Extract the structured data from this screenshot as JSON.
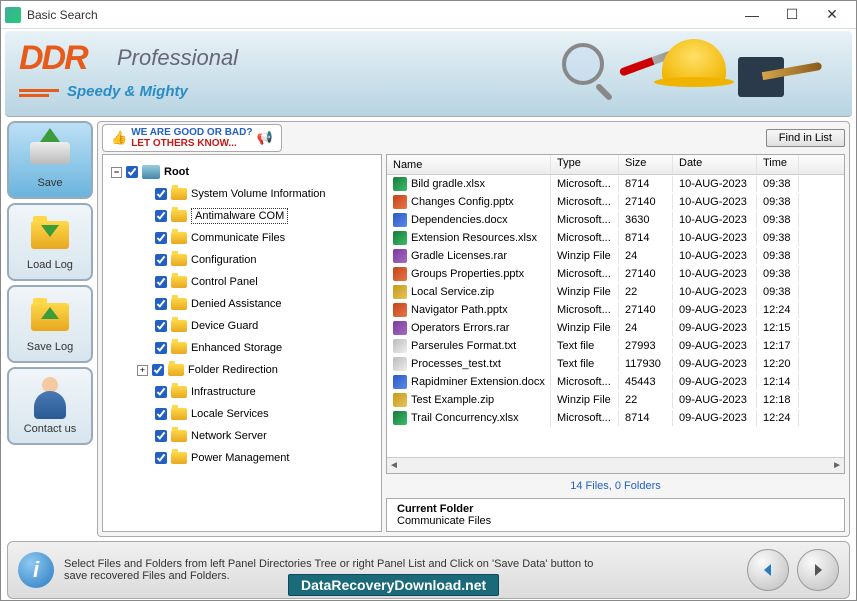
{
  "window": {
    "title": "Basic Search"
  },
  "banner": {
    "brand": "DDR",
    "edition": "Professional",
    "tagline": "Speedy & Mighty"
  },
  "sidebar": {
    "items": [
      {
        "id": "save",
        "label": "Save"
      },
      {
        "id": "load-log",
        "label": "Load Log"
      },
      {
        "id": "save-log",
        "label": "Save Log"
      },
      {
        "id": "contact",
        "label": "Contact us"
      }
    ]
  },
  "promo": {
    "line1": "WE ARE GOOD OR BAD?",
    "line2": "LET OTHERS KNOW..."
  },
  "find_button": "Find in List",
  "tree": {
    "root": "Root",
    "children": [
      "System Volume Information",
      "Antimalware COM",
      "Communicate Files",
      "Configuration",
      "Control Panel",
      "Denied Assistance",
      "Device Guard",
      "Enhanced Storage",
      "Folder Redirection",
      "Infrastructure",
      "Locale Services",
      "Network Server",
      "Power Management"
    ],
    "selected_index": 1,
    "expandable_child_index": 8
  },
  "list": {
    "columns": [
      "Name",
      "Type",
      "Size",
      "Date",
      "Time"
    ],
    "rows": [
      {
        "icon": "xlsx",
        "name": "Bild gradle.xlsx",
        "type": "Microsoft...",
        "size": "8714",
        "date": "10-AUG-2023",
        "time": "09:38"
      },
      {
        "icon": "pptx",
        "name": "Changes Config.pptx",
        "type": "Microsoft...",
        "size": "27140",
        "date": "10-AUG-2023",
        "time": "09:38"
      },
      {
        "icon": "docx",
        "name": "Dependencies.docx",
        "type": "Microsoft...",
        "size": "3630",
        "date": "10-AUG-2023",
        "time": "09:38"
      },
      {
        "icon": "xlsx",
        "name": "Extension Resources.xlsx",
        "type": "Microsoft...",
        "size": "8714",
        "date": "10-AUG-2023",
        "time": "09:38"
      },
      {
        "icon": "rar",
        "name": "Gradle Licenses.rar",
        "type": "Winzip File",
        "size": "24",
        "date": "10-AUG-2023",
        "time": "09:38"
      },
      {
        "icon": "pptx",
        "name": "Groups Properties.pptx",
        "type": "Microsoft...",
        "size": "27140",
        "date": "10-AUG-2023",
        "time": "09:38"
      },
      {
        "icon": "zip",
        "name": "Local Service.zip",
        "type": "Winzip File",
        "size": "22",
        "date": "10-AUG-2023",
        "time": "09:38"
      },
      {
        "icon": "pptx",
        "name": "Navigator Path.pptx",
        "type": "Microsoft...",
        "size": "27140",
        "date": "09-AUG-2023",
        "time": "12:24"
      },
      {
        "icon": "rar",
        "name": "Operators Errors.rar",
        "type": "Winzip File",
        "size": "24",
        "date": "09-AUG-2023",
        "time": "12:15"
      },
      {
        "icon": "txt",
        "name": "Parserules Format.txt",
        "type": "Text file",
        "size": "27993",
        "date": "09-AUG-2023",
        "time": "12:17"
      },
      {
        "icon": "txt",
        "name": "Processes_test.txt",
        "type": "Text file",
        "size": "117930",
        "date": "09-AUG-2023",
        "time": "12:20"
      },
      {
        "icon": "docx",
        "name": "Rapidminer Extension.docx",
        "type": "Microsoft...",
        "size": "45443",
        "date": "09-AUG-2023",
        "time": "12:14"
      },
      {
        "icon": "zip",
        "name": "Test Example.zip",
        "type": "Winzip File",
        "size": "22",
        "date": "09-AUG-2023",
        "time": "12:18"
      },
      {
        "icon": "xlsx",
        "name": "Trail Concurrency.xlsx",
        "type": "Microsoft...",
        "size": "8714",
        "date": "09-AUG-2023",
        "time": "12:24"
      }
    ]
  },
  "status": "14 Files, 0 Folders",
  "current_folder": {
    "title": "Current Folder",
    "value": "Communicate Files"
  },
  "footer": {
    "hint": "Select Files and Folders from left Panel Directories Tree or right Panel List and Click on 'Save Data' button to save recovered Files and Folders.",
    "url": "DataRecoveryDownload.net"
  }
}
